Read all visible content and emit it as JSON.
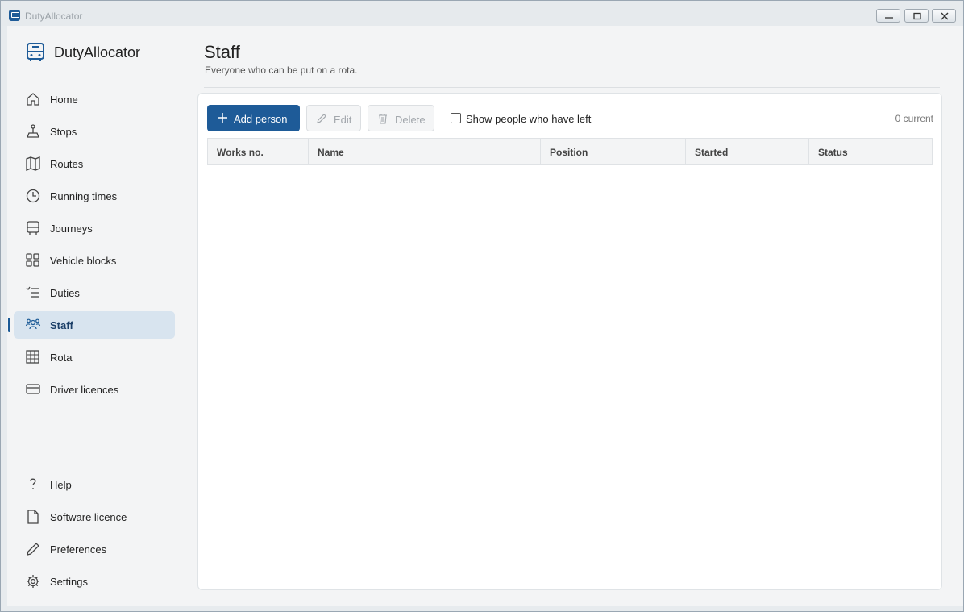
{
  "window": {
    "title": "DutyAllocator"
  },
  "brand": {
    "name": "DutyAllocator"
  },
  "nav": {
    "items": [
      {
        "label": "Home",
        "icon": "home-icon"
      },
      {
        "label": "Stops",
        "icon": "stop-icon"
      },
      {
        "label": "Routes",
        "icon": "map-icon"
      },
      {
        "label": "Running times",
        "icon": "clock-icon"
      },
      {
        "label": "Journeys",
        "icon": "bus-icon"
      },
      {
        "label": "Vehicle blocks",
        "icon": "grid-icon"
      },
      {
        "label": "Duties",
        "icon": "checklist-icon"
      },
      {
        "label": "Staff",
        "icon": "people-icon"
      },
      {
        "label": "Rota",
        "icon": "table-icon"
      },
      {
        "label": "Driver licences",
        "icon": "card-icon"
      }
    ],
    "bottom": [
      {
        "label": "Help",
        "icon": "help-icon"
      },
      {
        "label": "Software licence",
        "icon": "document-icon"
      },
      {
        "label": "Preferences",
        "icon": "pen-icon"
      },
      {
        "label": "Settings",
        "icon": "gear-icon"
      }
    ],
    "active": "Staff"
  },
  "page": {
    "title": "Staff",
    "subtitle": "Everyone who can be put on a rota."
  },
  "toolbar": {
    "add_label": "Add person",
    "edit_label": "Edit",
    "delete_label": "Delete",
    "show_left_label": "Show people who have left",
    "show_left_checked": false,
    "count_text": "0 current"
  },
  "table": {
    "columns": [
      "Works no.",
      "Name",
      "Position",
      "Started",
      "Status"
    ],
    "rows": []
  },
  "colors": {
    "accent": "#1e5b98",
    "active_bg": "#d8e4ef"
  }
}
